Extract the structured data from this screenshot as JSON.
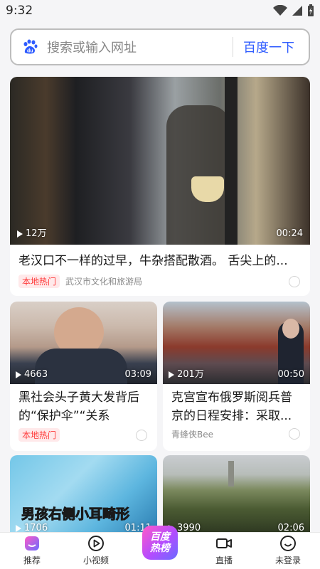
{
  "status_bar": {
    "time": "9:32"
  },
  "search": {
    "placeholder": "搜索或输入网址",
    "button_label": "百度一下"
  },
  "feed": {
    "featured": {
      "views": "12万",
      "duration": "00:24",
      "title": "老汉口不一样的过早，牛杂搭配散酒。 舌尖上的...",
      "badge": "本地热门",
      "source": "武汉市文化和旅游局"
    },
    "left_1": {
      "views": "4663",
      "duration": "03:09",
      "title": "黑社会头子黄大发背后的“保护伞”“关系网”需...",
      "badge": "本地热门"
    },
    "right_1": {
      "views": "201万",
      "duration": "00:50",
      "title": "克宫宣布俄罗斯阅兵普京的日程安排：采取...",
      "source": "青蜂侠Bee"
    },
    "left_2": {
      "views": "1706",
      "duration": "01:11",
      "caption": "男孩右侧小耳畸形"
    },
    "right_2": {
      "views": "3990",
      "duration": "02:06"
    }
  },
  "bottom_nav": {
    "items": [
      {
        "label": "推荐",
        "icon": "home-icon"
      },
      {
        "label": "小视频",
        "icon": "video-play-icon"
      },
      {
        "label": "百度热榜",
        "line1": "百度",
        "line2": "热榜",
        "icon": "hot-list-icon"
      },
      {
        "label": "直播",
        "icon": "live-camera-icon"
      },
      {
        "label": "未登录",
        "icon": "smiley-icon"
      }
    ]
  },
  "colors": {
    "accent": "#2f5cff",
    "badge_red": "#ff3b3b",
    "badge_bg": "#ffe9ea"
  }
}
